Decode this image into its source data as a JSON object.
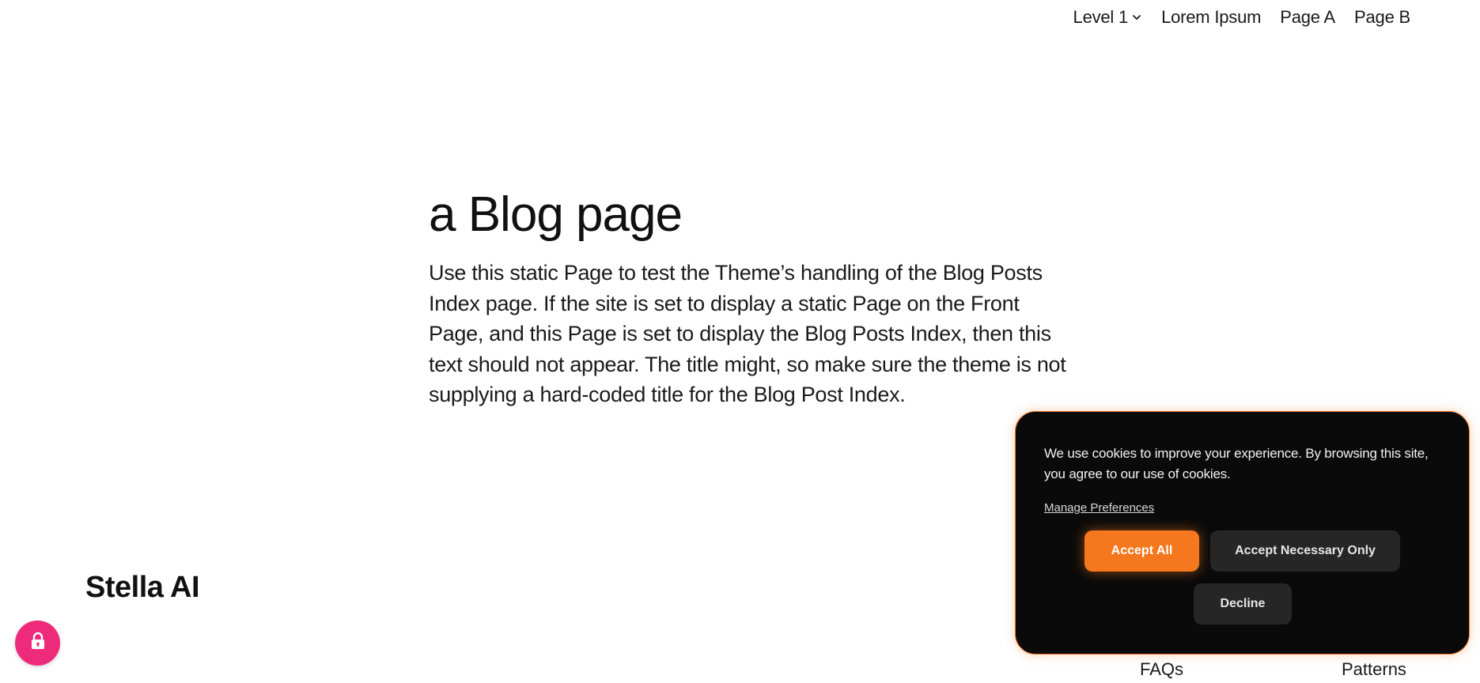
{
  "nav": {
    "items": [
      {
        "label": "Level 1",
        "has_dropdown": true,
        "icon": "chevron-down-icon"
      },
      {
        "label": "Lorem Ipsum",
        "has_dropdown": false
      },
      {
        "label": "Page A",
        "has_dropdown": false
      },
      {
        "label": "Page B",
        "has_dropdown": false
      }
    ]
  },
  "main": {
    "title": "a Blog page",
    "body": "Use this static Page to test the Theme’s handling of the Blog Posts Index page. If the site is set to display a static Page on the Front Page, and this Page is set to display the Blog Posts Index, then this text should not appear. The title might, so make sure the theme is not supplying a hard-coded title for the Blog Post Index."
  },
  "footer": {
    "brand": "Stella AI",
    "links": [
      "FAQs",
      "Patterns"
    ]
  },
  "lock_button": {
    "icon": "lock-icon",
    "color": "#ee2a7b"
  },
  "cookie_banner": {
    "text": "We use cookies to improve your experience. By browsing this site, you agree to our use of cookies.",
    "manage_label": "Manage Preferences",
    "accept_all_label": "Accept All",
    "accept_necessary_label": "Accept Necessary Only",
    "decline_label": "Decline",
    "colors": {
      "background": "#0a0a0a",
      "accent": "#f5781e",
      "secondary_button": "#262626"
    }
  }
}
